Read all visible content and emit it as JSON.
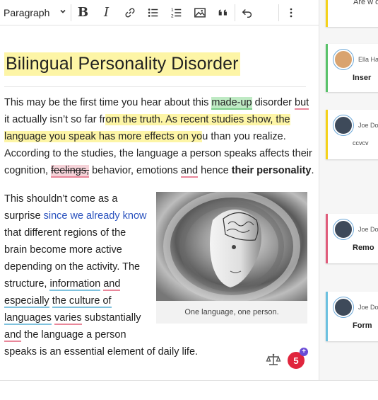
{
  "toolbar": {
    "block_format": "Paragraph",
    "bold_label": "B",
    "italic_label": "I"
  },
  "document": {
    "title": "Bilingual Personality Disorder",
    "para1": {
      "a": "This may be the first time you hear about this ",
      "b": "made-up",
      "c": " disorder ",
      "d": "but",
      "e": " it actually isn’t so far fr",
      "f": "om the truth. As recent studies show, the language you speak has more effects on yo",
      "g": "u than you realize. According to the studies, the language a person speaks affects their cognition, ",
      "h": "feelings,",
      "i": " behavior, emotions ",
      "j": "and",
      "k": " hence ",
      "l": "their personality",
      "m": "."
    },
    "para2": {
      "a": "This shouldn’t come as a surprise ",
      "link": "since we already know",
      "b": " that different regions of the brain become more active depending on the activity. The structure, ",
      "c": "information",
      "d": " ",
      "e": "and",
      "f": " ",
      "g": "especially",
      "h": " ",
      "i": "the culture of languages",
      "j": " ",
      "k": "varies",
      "l": " substantially ",
      "m": "and",
      "n": " the language a person speaks is an essential element of daily life."
    },
    "figure_caption": "One language, one person."
  },
  "badges": {
    "issue_count": "5",
    "plus": "+"
  },
  "sidebar": {
    "top_card_text": "Are w disor",
    "cards": [
      {
        "author": "Ella Ha",
        "text": "Inser",
        "color": "#59c26a"
      },
      {
        "author": "Joe Do",
        "text": "ccvcv",
        "color": "#f5d21a"
      },
      {
        "author": "Joe Do",
        "text": "Remo",
        "color": "#e05d7c"
      },
      {
        "author": "Joe Do",
        "text": "Form",
        "color": "#6cc1e0"
      }
    ]
  },
  "colors": {
    "highlight_yellow": "#fdf5a6",
    "highlight_green": "#bfeac4",
    "underline_red": "#e9879a",
    "underline_blue": "#7fc2de",
    "link_blue": "#2a52be",
    "badge_red": "#e0253d",
    "badge_purple": "#6a4bd6"
  },
  "icons": [
    "chevron-down-icon",
    "bold-icon",
    "italic-icon",
    "link-icon",
    "bulleted-list-icon",
    "numbered-list-icon",
    "image-icon",
    "blockquote-icon",
    "undo-icon",
    "more-vertical-icon",
    "scale-icon"
  ]
}
